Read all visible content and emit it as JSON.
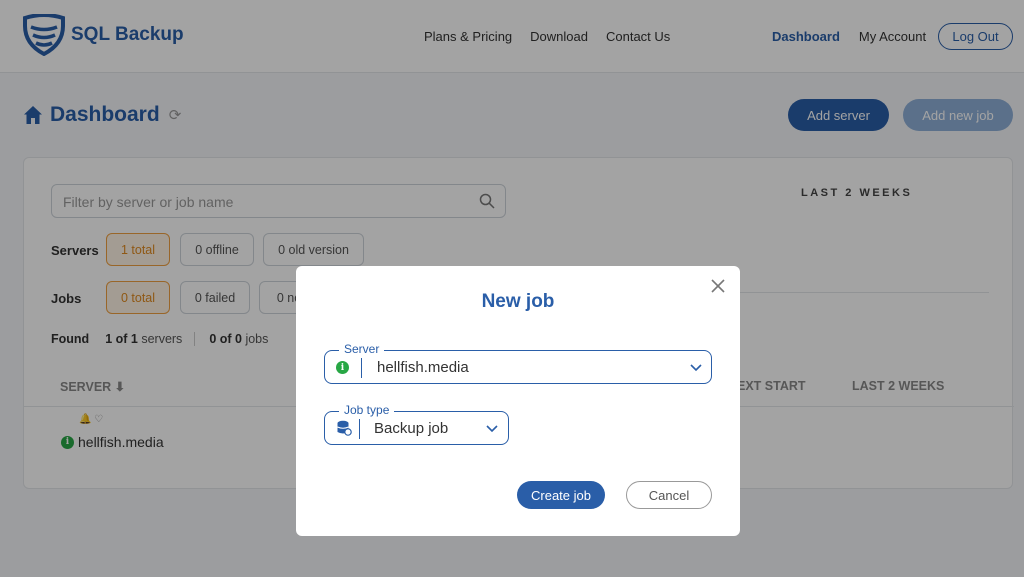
{
  "header": {
    "brand": "SQL Backup",
    "nav_center": [
      "Plans & Pricing",
      "Download",
      "Contact Us"
    ],
    "nav_right": {
      "dashboard": "Dashboard",
      "account": "My Account",
      "logout": "Log Out"
    }
  },
  "page": {
    "title": "Dashboard",
    "add_server": "Add server",
    "add_new_job": "Add new job"
  },
  "panel": {
    "filter_placeholder": "Filter by server or job name",
    "last_weeks_heading": "LAST 2 WEEKS",
    "servers_label": "Servers",
    "servers_chips": [
      "1 total",
      "0 offline",
      "0 old version"
    ],
    "jobs_label": "Jobs",
    "jobs_chips": [
      "0 total",
      "0 failed",
      "0 no"
    ],
    "found_label": "Found",
    "found_servers": {
      "count": "1 of 1",
      "unit": "servers"
    },
    "found_jobs": {
      "count": "0 of 0",
      "unit": "jobs"
    },
    "columns": {
      "server": "SERVER",
      "next_start": "EXT START",
      "last_2_weeks": "LAST 2 WEEKS"
    },
    "server_row": {
      "name": "hellfish.media"
    }
  },
  "modal": {
    "title": "New job",
    "server_legend": "Server",
    "server_value": "hellfish.media",
    "job_type_legend": "Job type",
    "job_type_value": "Backup job",
    "create_label": "Create job",
    "cancel_label": "Cancel"
  },
  "colors": {
    "brand": "#2a5ea8",
    "highlight": "#e08a20",
    "status_ok": "#28a745"
  }
}
